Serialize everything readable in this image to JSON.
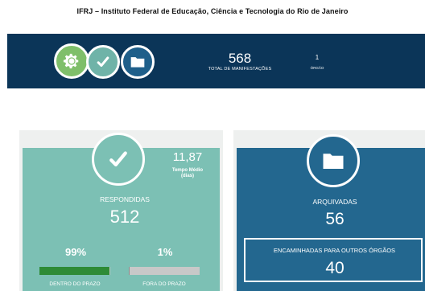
{
  "header": {
    "title": "IFRJ – Instituto Federal de Educação, Ciência e Tecnologia do Rio de Janeiro"
  },
  "summary": {
    "icons": [
      "gear-icon",
      "check-icon",
      "folder-icon"
    ],
    "total_value": "568",
    "total_label": "TOTAL DE MANIFESTAÇÕES",
    "orgs_value": "1",
    "orgs_label": "ÓRGÃO"
  },
  "respondidas": {
    "icon": "check-icon",
    "tempo_medio_value": "11,87",
    "tempo_medio_label": "Tempo Médio",
    "tempo_medio_unit": "(dias)",
    "label": "RESPONDIDAS",
    "value": "512",
    "dentro_pct": "99%",
    "fora_pct": "1%",
    "dentro_fraction": 0.99,
    "fora_fraction": 0.01,
    "dentro_label": "DENTRO DO PRAZO",
    "fora_label": "FORA DO PRAZO"
  },
  "arquivadas": {
    "icon": "folder-icon",
    "label": "ARQUIVADAS",
    "value": "56",
    "encaminhadas_label": "ENCAMINHADAS PARA OUTROS ÓRGÃOS",
    "encaminhadas_value": "40"
  },
  "colors": {
    "navy": "#0b3558",
    "teal": "#7cc0b4",
    "blue": "#23678f",
    "green": "#2e8b36",
    "gear_green": "#7fbf6a"
  }
}
